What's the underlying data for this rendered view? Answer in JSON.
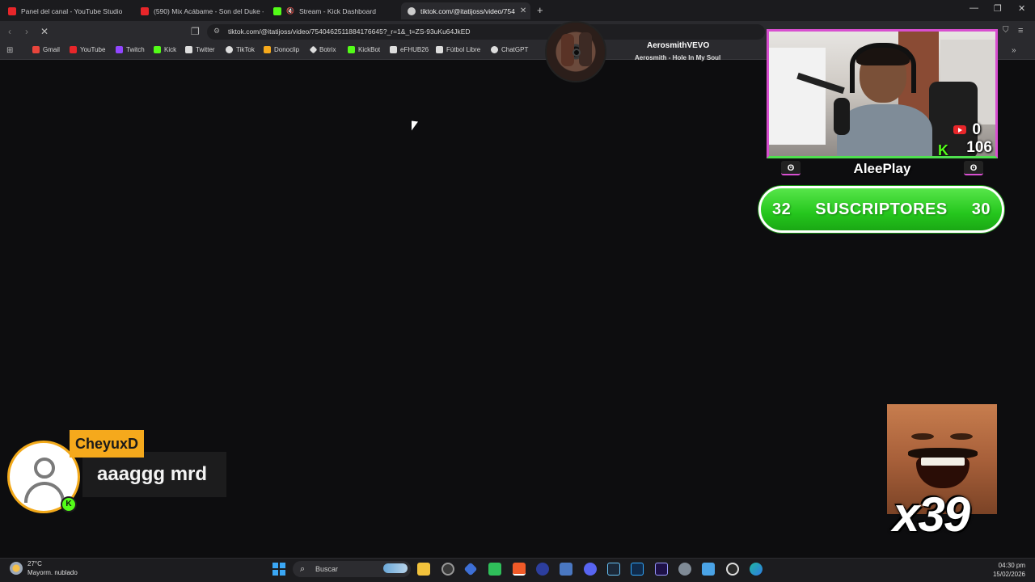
{
  "browser": {
    "tabs": [
      {
        "label": "Panel del canal - YouTube Studio",
        "color": "#e8262a"
      },
      {
        "label": "(590) Mix Acábame - Son del Duke -",
        "color": "#e8262a"
      },
      {
        "label": "Stream - Kick Dashboard",
        "color": "#53fc18"
      },
      {
        "label": "tiktok.com/@itatijoss/video/754",
        "color": "#cccccc",
        "active": true
      }
    ],
    "url": "tiktok.com/@itatijoss/video/7540462511884176645?_r=1&_t=ZS-93uKu64JkED",
    "bookmarks": [
      {
        "label": "Gmail",
        "color": "#e8453c"
      },
      {
        "label": "YouTube",
        "color": "#e8262a"
      },
      {
        "label": "Twitch",
        "color": "#9146ff"
      },
      {
        "label": "Kick",
        "color": "#53fc18"
      },
      {
        "label": "Twitter",
        "color": "#dddddd"
      },
      {
        "label": "TikTok",
        "color": "#dddddd"
      },
      {
        "label": "Donoclip",
        "color": "#f5a91c"
      },
      {
        "label": "Botrix",
        "color": "#dddddd"
      },
      {
        "label": "KickBot",
        "color": "#53fc18"
      },
      {
        "label": "eFHUB26",
        "color": "#dddddd"
      },
      {
        "label": "Fútbol Libre",
        "color": "#dddddd"
      },
      {
        "label": "ChatGPT",
        "color": "#dddddd"
      }
    ]
  },
  "now_playing": {
    "artist": "AerosmithVEVO",
    "song": "Aerosmith - Hole In My Soul"
  },
  "overlay": {
    "youtube_count": "0",
    "kick_count": "106",
    "streamer_name": "AleePlay",
    "subs_left": "32",
    "subs_label": "SUSCRIPTORES",
    "subs_right": "30",
    "chat_user": "CheyuxD",
    "chat_message": "aaaggg mrd",
    "combo": "x39"
  },
  "taskbar": {
    "temp": "27°C",
    "weather": "Mayorm. nublado",
    "search_placeholder": "Buscar",
    "time": "04:30 pm",
    "date": "15/02/2026"
  }
}
